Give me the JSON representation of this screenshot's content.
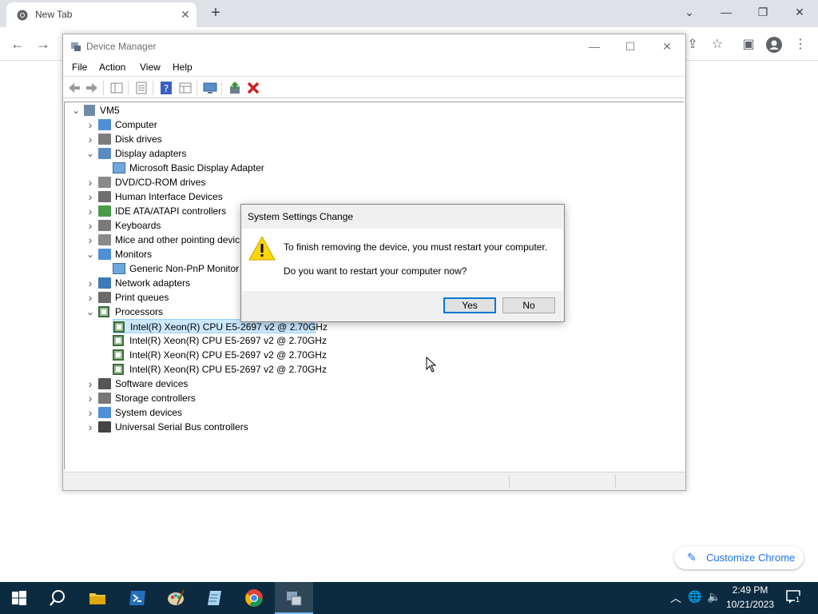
{
  "browser": {
    "tab_title": "New Tab",
    "tab_close": "✕",
    "new_tab": "+",
    "window_controls": {
      "dropdown": "⌄",
      "minimize": "—",
      "restore": "❐",
      "close": "✕"
    },
    "customize_label": "Customize Chrome"
  },
  "device_manager": {
    "title": "Device Manager",
    "menu": [
      "File",
      "Action",
      "View",
      "Help"
    ],
    "tree": {
      "root": "VM5",
      "items": [
        {
          "label": "Computer",
          "expanded": false,
          "icon": "computer-icon"
        },
        {
          "label": "Disk drives",
          "expanded": false,
          "icon": "disk-drive-icon"
        },
        {
          "label": "Display adapters",
          "expanded": true,
          "icon": "display-adapter-icon",
          "children": [
            "Microsoft Basic Display Adapter"
          ]
        },
        {
          "label": "DVD/CD-ROM drives",
          "expanded": false,
          "icon": "dvd-icon"
        },
        {
          "label": "Human Interface Devices",
          "expanded": false,
          "icon": "hid-icon"
        },
        {
          "label": "IDE ATA/ATAPI controllers",
          "expanded": false,
          "icon": "ide-icon"
        },
        {
          "label": "Keyboards",
          "expanded": false,
          "icon": "keyboard-icon"
        },
        {
          "label": "Mice and other pointing devic",
          "expanded": false,
          "icon": "mouse-icon"
        },
        {
          "label": "Monitors",
          "expanded": true,
          "icon": "monitor-icon",
          "children": [
            "Generic Non-PnP Monitor"
          ]
        },
        {
          "label": "Network adapters",
          "expanded": false,
          "icon": "network-icon"
        },
        {
          "label": "Print queues",
          "expanded": false,
          "icon": "printer-icon"
        },
        {
          "label": "Processors",
          "expanded": true,
          "icon": "processor-icon",
          "children": [
            "Intel(R) Xeon(R) CPU E5-2697 v2 @ 2.70GHz",
            "Intel(R) Xeon(R) CPU E5-2697 v2 @ 2.70GHz",
            "Intel(R) Xeon(R) CPU E5-2697 v2 @ 2.70GHz",
            "Intel(R) Xeon(R) CPU E5-2697 v2 @ 2.70GHz"
          ]
        },
        {
          "label": "Software devices",
          "expanded": false,
          "icon": "software-device-icon"
        },
        {
          "label": "Storage controllers",
          "expanded": false,
          "icon": "storage-icon"
        },
        {
          "label": "System devices",
          "expanded": false,
          "icon": "system-device-icon"
        },
        {
          "label": "Universal Serial Bus controllers",
          "expanded": false,
          "icon": "usb-icon"
        }
      ]
    }
  },
  "dialog": {
    "title": "System Settings Change",
    "message1": "To finish removing the device, you must restart your computer.",
    "message2": "Do you want to restart your computer now?",
    "yes_label": "Yes",
    "no_label": "No",
    "icon": "warning-icon"
  },
  "taskbar": {
    "time": "2:49 PM",
    "date": "10/21/2023",
    "notification_count": "1"
  },
  "colors": {
    "taskbar": "#0c2b40",
    "chrome_tabstrip": "#dee1e6",
    "selection": "#cce8ff",
    "accent": "#0078d7",
    "warning": "#ffd700"
  }
}
